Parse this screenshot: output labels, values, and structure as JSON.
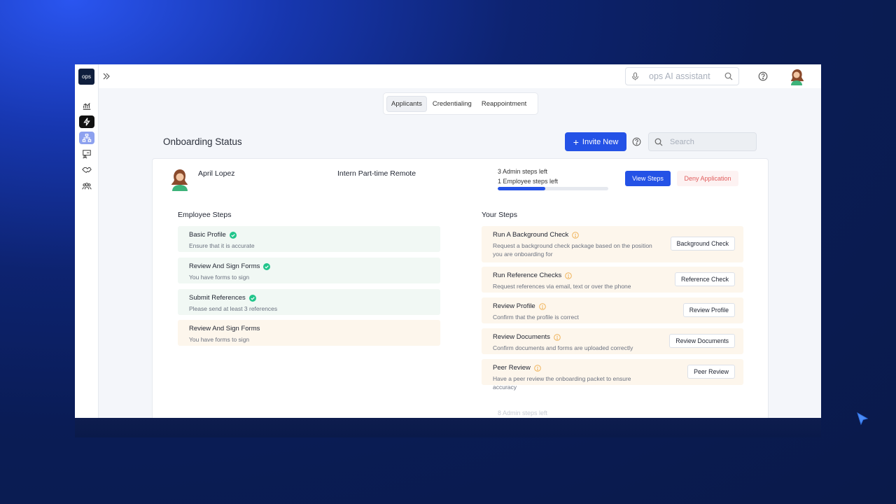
{
  "sidebar": {
    "logo": "ops",
    "icons": [
      "analytics-icon",
      "bolt-icon",
      "org-chart-icon",
      "presentation-icon",
      "handshake-icon",
      "team-icon"
    ]
  },
  "topbar": {
    "ai_placeholder": "ops AI assistant"
  },
  "tabs": [
    {
      "label": "Applicants",
      "active": true
    },
    {
      "label": "Credentialing",
      "active": false
    },
    {
      "label": "Reappointment",
      "active": false
    }
  ],
  "header": {
    "title": "Onboarding Status",
    "invite_label": "Invite New",
    "search_placeholder": "Search"
  },
  "applicant": {
    "name": "April Lopez",
    "role": "Intern Part-time Remote",
    "admin_steps_left": "3 Admin steps left",
    "employee_steps_left": "1 Employee steps left",
    "progress_fraction": 0.43,
    "view_label": "View Steps",
    "deny_label": "Deny Application"
  },
  "employee_steps": {
    "title": "Employee Steps",
    "items": [
      {
        "title": "Basic Profile",
        "desc": "Ensure that it is accurate",
        "done": true
      },
      {
        "title": "Review And Sign Forms",
        "desc": "You have forms to sign",
        "done": true
      },
      {
        "title": "Submit References",
        "desc": "Please send at least 3 references",
        "done": true
      },
      {
        "title": "Review And Sign Forms",
        "desc": "You have forms to sign",
        "done": false
      }
    ]
  },
  "your_steps": {
    "title": "Your Steps",
    "items": [
      {
        "title": "Run A Background Check",
        "desc": "Request a background check package based on the position you are onboarding for",
        "action": "Background Check"
      },
      {
        "title": "Run Reference Checks",
        "desc": "Request references via email, text or over the phone",
        "action": "Reference Check"
      },
      {
        "title": "Review Profile",
        "desc": "Confirm that the profile is correct",
        "action": "Review Profile"
      },
      {
        "title": "Review Documents",
        "desc": "Confirm documents and forms are uploaded correctly",
        "action": "Review Documents"
      },
      {
        "title": "Peer Review",
        "desc": "Have a peer review the onboarding packet to ensure accuracy",
        "action": "Peer Review"
      }
    ]
  },
  "next_row": {
    "admin_steps_left": "8 Admin steps left"
  },
  "colors": {
    "accent": "#2452e6",
    "done_bg": "#f1f8f4",
    "pending_bg": "#fdf6ec",
    "check": "#22c58b",
    "warn": "#f0b35a"
  }
}
